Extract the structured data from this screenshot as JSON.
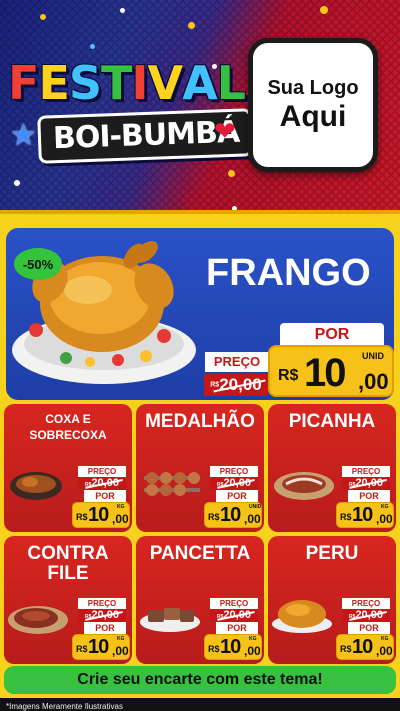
{
  "header": {
    "festival_title": "FESTIVAL",
    "festival_subtitle": "BOI-BUMBÁ",
    "logo_line1": "Sua Logo",
    "logo_line2": "Aqui"
  },
  "featured": {
    "discount": "-50%",
    "name": "FRANGO",
    "preco_label": "PREÇO",
    "old_currency": "R$",
    "old_price": "20,00",
    "por_label": "POR",
    "currency": "R$",
    "price_int": "10",
    "price_dec": ",00",
    "unit": "UNID"
  },
  "products": [
    {
      "name": "COXA E SOBRECOXA",
      "preco_label": "PREÇO",
      "old_currency": "R$",
      "old_price": "20,00",
      "por_label": "POR",
      "currency": "R$",
      "price_int": "10",
      "price_dec": ",00",
      "unit": "KG"
    },
    {
      "name": "MEDALHÃO",
      "preco_label": "PREÇO",
      "old_currency": "R$",
      "old_price": "20,00",
      "por_label": "POR",
      "currency": "R$",
      "price_int": "10",
      "price_dec": ",00",
      "unit": "UNID"
    },
    {
      "name": "PICANHA",
      "preco_label": "PREÇO",
      "old_currency": "R$",
      "old_price": "20,00",
      "por_label": "POR",
      "currency": "R$",
      "price_int": "10",
      "price_dec": ",00",
      "unit": "KG"
    },
    {
      "name": "CONTRA FILE",
      "preco_label": "PREÇO",
      "old_currency": "R$",
      "old_price": "20,00",
      "por_label": "POR",
      "currency": "R$",
      "price_int": "10",
      "price_dec": ",00",
      "unit": "KG"
    },
    {
      "name": "PANCETTA",
      "preco_label": "PREÇO",
      "old_currency": "R$",
      "old_price": "20,00",
      "por_label": "POR",
      "currency": "R$",
      "price_int": "10",
      "price_dec": ",00",
      "unit": "KG"
    },
    {
      "name": "PERU",
      "preco_label": "PREÇO",
      "old_currency": "R$",
      "old_price": "20,00",
      "por_label": "POR",
      "currency": "R$",
      "price_int": "10",
      "price_dec": ",00",
      "unit": "KG"
    }
  ],
  "cta": "Crie seu encarte com este tema!",
  "footnote": "*Imagens Meramente Ilustrativas",
  "colors": {
    "blue": "#1d3ea6",
    "red": "#c41717",
    "yellow": "#f6d21c",
    "green": "#38c040"
  }
}
